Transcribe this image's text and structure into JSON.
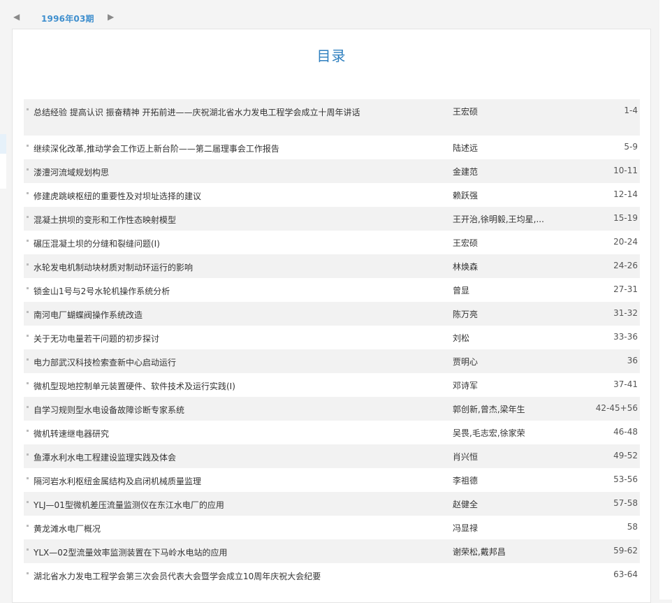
{
  "issue_tab": {
    "prev_icon": "triangle-left",
    "label": "1996年03期",
    "next_icon": "triangle-right"
  },
  "toc": {
    "title": "目录",
    "articles": [
      {
        "title": "总结经验 提高认识 振奋精神 开拓前进——庆祝湖北省水力发电工程学会成立十周年讲话",
        "author": "王宏硕",
        "pages": "1-4"
      },
      {
        "title": "继续深化改革,推动学会工作迈上新台阶——第二届理事会工作报告",
        "author": "陆述远",
        "pages": "5-9"
      },
      {
        "title": "溇澧河流域规划构思",
        "author": "金建范",
        "pages": "10-11"
      },
      {
        "title": "修建虎跳峡枢纽的重要性及对坝址选择的建议",
        "author": "赖跃强",
        "pages": "12-14"
      },
      {
        "title": "混凝土拱坝的变形和工作性态映射模型",
        "author": "王开治,徐明毅,王均星,...",
        "pages": "15-19"
      },
      {
        "title": "碾压混凝土坝的分缝和裂缝问题(Ⅰ)",
        "author": "王宏硕",
        "pages": "20-24"
      },
      {
        "title": "水轮发电机制动块材质对制动环运行的影响",
        "author": "林焕森",
        "pages": "24-26"
      },
      {
        "title": "锁金山1号与2号水轮机操作系统分析",
        "author": "曾显",
        "pages": "27-31"
      },
      {
        "title": "南河电厂蝴蝶阀操作系统改造",
        "author": "陈万亮",
        "pages": "31-32"
      },
      {
        "title": "关于无功电量若干问题的初步探讨",
        "author": "刘松",
        "pages": "33-36"
      },
      {
        "title": "电力部武汉科技检索查新中心启动运行",
        "author": "贾明心",
        "pages": "36"
      },
      {
        "title": "微机型现地控制单元装置硬件、软件技术及运行实践(Ⅰ)",
        "author": "邓诗军",
        "pages": "37-41"
      },
      {
        "title": "自学习规则型水电设备故障诊断专家系统",
        "author": "郭创新,曾杰,梁年生",
        "pages": "42-45+56"
      },
      {
        "title": "微机转速继电器研究",
        "author": "吴畏,毛志宏,徐家荣",
        "pages": "46-48"
      },
      {
        "title": "鱼潭水利水电工程建设监理实践及体会",
        "author": "肖兴恒",
        "pages": "49-52"
      },
      {
        "title": "隔河岩水利枢纽金属结构及启闭机械质量监理",
        "author": "李祖德",
        "pages": "53-56"
      },
      {
        "title": "YLJ—01型微机差压流量监测仪在东江水电厂的应用",
        "author": "赵健全",
        "pages": "57-58"
      },
      {
        "title": "黄龙滩水电厂概况",
        "author": "冯显禄",
        "pages": "58"
      },
      {
        "title": "YLX—02型流量效率监测装置在下马岭水电站的应用",
        "author": "谢荣松,戴邦昌",
        "pages": "59-62"
      },
      {
        "title": "湖北省水力发电工程学会第三次会员代表大会暨学会成立10周年庆祝大会纪要",
        "author": "",
        "pages": "63-64"
      }
    ]
  }
}
